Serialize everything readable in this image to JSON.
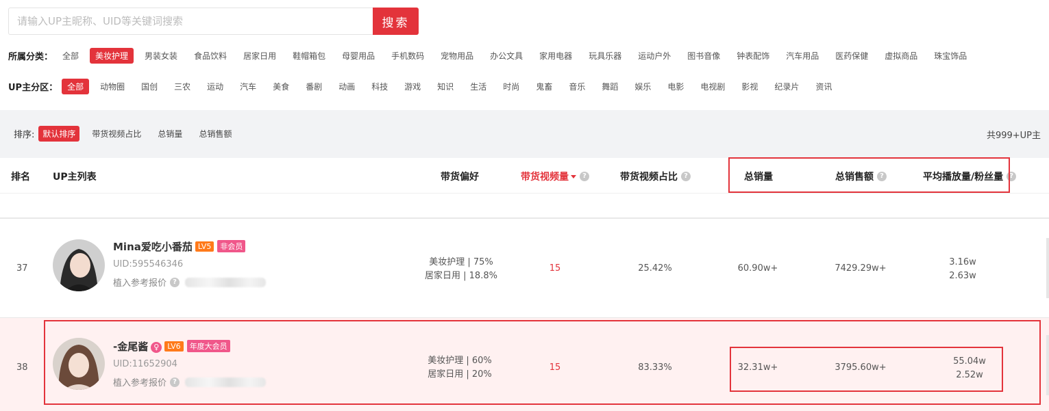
{
  "search": {
    "placeholder": "请输入UP主昵称、UID等关键词搜索",
    "button": "搜索"
  },
  "category": {
    "label": "所属分类：",
    "items": [
      "全部",
      "美妆护理",
      "男装女装",
      "食品饮料",
      "居家日用",
      "鞋帽箱包",
      "母婴用品",
      "手机数码",
      "宠物用品",
      "办公文具",
      "家用电器",
      "玩具乐器",
      "运动户外",
      "图书音像",
      "钟表配饰",
      "汽车用品",
      "医药保健",
      "虚拟商品",
      "珠宝饰品"
    ],
    "active": 1
  },
  "zone": {
    "label": "UP主分区：",
    "items": [
      "全部",
      "动物圈",
      "国创",
      "三农",
      "运动",
      "汽车",
      "美食",
      "番剧",
      "动画",
      "科技",
      "游戏",
      "知识",
      "生活",
      "时尚",
      "鬼畜",
      "音乐",
      "舞蹈",
      "娱乐",
      "电影",
      "电视剧",
      "影视",
      "纪录片",
      "资讯"
    ],
    "active": 0
  },
  "sort": {
    "label": "排序:",
    "items": [
      "默认排序",
      "带货视频占比",
      "总销量",
      "总销售额"
    ],
    "active": 0,
    "total": "共999+UP主"
  },
  "table": {
    "headers": {
      "rank": "排名",
      "list": "UP主列表",
      "preference": "带货偏好",
      "video_count": "带货视频量",
      "video_ratio": "带货视频占比",
      "total_sales": "总销量",
      "total_revenue": "总销售额",
      "avg_play_fans": "平均播放量/粉丝量"
    },
    "rows": [
      {
        "rank": "37",
        "name": "Mina爱吃小番茄",
        "level": "LV5",
        "member": "非会员",
        "uid": "UID:595546346",
        "quote_label": "植入参考报价",
        "pref1": "美妆护理 | 75%",
        "pref2": "居家日用 | 18.8%",
        "video_count": "15",
        "video_ratio": "25.42%",
        "total_sales": "60.90w+",
        "total_revenue": "7429.29w+",
        "avg_play": "3.16w",
        "fans": "2.63w"
      },
      {
        "rank": "38",
        "name": "-金尾酱",
        "level": "LV6",
        "member": "年度大会员",
        "uid": "UID:11652904",
        "quote_label": "植入参考报价",
        "pref1": "美妆护理 | 60%",
        "pref2": "居家日用 | 20%",
        "video_count": "15",
        "video_ratio": "83.33%",
        "total_sales": "32.31w+",
        "total_revenue": "3795.60w+",
        "avg_play": "55.04w",
        "fans": "2.52w"
      }
    ]
  },
  "colors": {
    "accent": "#e3333b",
    "level": "#ff7a1a",
    "vip": "#f0578a",
    "highlight_row": "#fff1f1"
  }
}
